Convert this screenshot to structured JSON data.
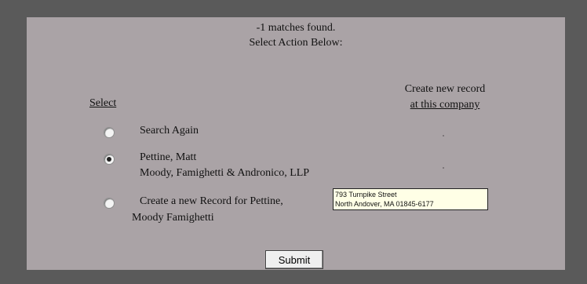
{
  "header": {
    "matches": "-1 matches found.",
    "instruction": "Select Action Below:"
  },
  "columns": {
    "select": "Select",
    "create_line1": "Create new record",
    "create_line2": "at this company"
  },
  "options": [
    {
      "lines": [
        "Search Again"
      ],
      "checked": false
    },
    {
      "lines": [
        "Pettine, Matt",
        "Moody, Famighetti & Andronico, LLP"
      ],
      "checked": true
    },
    {
      "lines": [
        "Create a new Record for Pettine,",
        "Moody Famighetti"
      ],
      "checked": false
    }
  ],
  "tooltip": {
    "line1": "793 Turnpike Street",
    "line2": "North Andover, MA  01845-6177"
  },
  "submit_label": "Submit"
}
